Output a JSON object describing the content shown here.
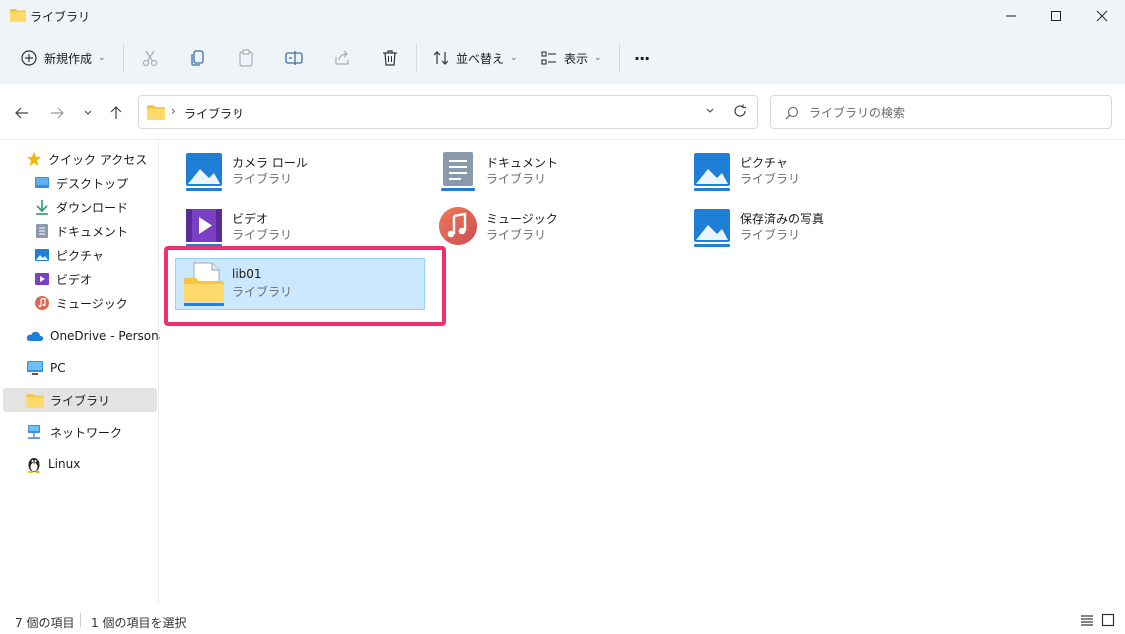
{
  "window": {
    "title": "ライブラリ"
  },
  "toolbar": {
    "new_label": "新規作成",
    "sort_label": "並べ替え",
    "view_label": "表示",
    "more_label": "···"
  },
  "address": {
    "crumb": "ライブラリ",
    "separator": "›"
  },
  "search": {
    "placeholder": "ライブラリの検索"
  },
  "sidebar": {
    "quick_access": "クイック アクセス",
    "items": [
      {
        "label": "デスクトップ",
        "icon": "desktop-icon"
      },
      {
        "label": "ダウンロード",
        "icon": "download-icon"
      },
      {
        "label": "ドキュメント",
        "icon": "document-icon"
      },
      {
        "label": "ピクチャ",
        "icon": "picture-icon"
      },
      {
        "label": "ビデオ",
        "icon": "video-icon"
      },
      {
        "label": "ミュージック",
        "icon": "music-icon"
      }
    ],
    "onedrive": "OneDrive - Personal",
    "pc": "PC",
    "libraries": "ライブラリ",
    "network": "ネットワーク",
    "linux": "Linux"
  },
  "libraries": [
    {
      "name": "カメラ ロール",
      "kind": "ライブラリ",
      "icon": "camera-roll-icon"
    },
    {
      "name": "ドキュメント",
      "kind": "ライブラリ",
      "icon": "documents-library-icon"
    },
    {
      "name": "ピクチャ",
      "kind": "ライブラリ",
      "icon": "pictures-library-icon"
    },
    {
      "name": "ビデオ",
      "kind": "ライブラリ",
      "icon": "videos-library-icon"
    },
    {
      "name": "ミュージック",
      "kind": "ライブラリ",
      "icon": "music-library-icon"
    },
    {
      "name": "保存済みの写真",
      "kind": "ライブラリ",
      "icon": "saved-pictures-icon"
    },
    {
      "name": "lib01",
      "kind": "ライブラリ",
      "icon": "custom-library-icon"
    }
  ],
  "status": {
    "item_count": "7 個の項目",
    "selected": "1 個の項目を選択"
  },
  "colors": {
    "chrome": "#eff4f9",
    "selection": "#cce8ff",
    "highlight": "#f0306a",
    "folder": "#f4c542"
  }
}
